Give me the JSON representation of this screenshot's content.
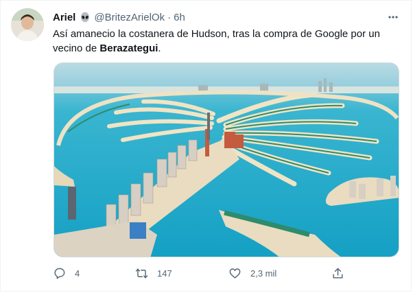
{
  "tweet": {
    "author_name": "Ariel",
    "author_emoji_icon": "alien-icon",
    "handle": "@BritezArielOk",
    "separator": "·",
    "time": "6h",
    "text_before": "Así amanecio la costanera de Hudson, tras la compra de Google por un vecino de ",
    "text_bold": "Berazategui",
    "text_after": ".",
    "image_icon": "palm-island-aerial-photo"
  },
  "actions": {
    "reply_count": "4",
    "retweet_count": "147",
    "like_count": "2,3 mil",
    "reply_icon": "reply-icon",
    "retweet_icon": "retweet-icon",
    "like_icon": "heart-icon",
    "share_icon": "share-icon"
  },
  "colors": {
    "secondary_text": "#536471",
    "primary_text": "#0f1419",
    "sea": "#1fa9c9"
  }
}
